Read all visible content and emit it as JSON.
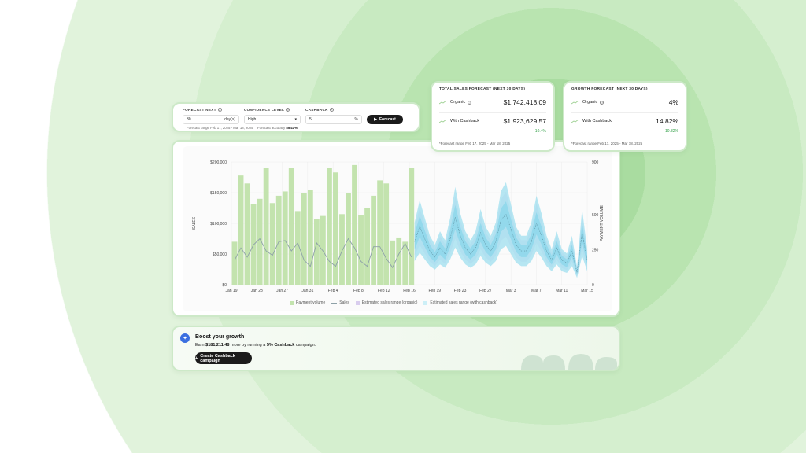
{
  "controls": {
    "labels": [
      "FORECAST NEXT",
      "CONFIDENCE LEVEL",
      "CASHBACK"
    ],
    "forecast_value": "30",
    "forecast_unit": "day(s)",
    "confidence_value": "High",
    "cashback_value": "5",
    "cashback_unit": "%",
    "forecast_button": "Forecast",
    "range_text": "Forecast range Feb 17, 2025 - Mar 18, 2025",
    "accuracy_label": "Forecast accuracy",
    "accuracy_value": "85.41%"
  },
  "total_sales": {
    "header": "TOTAL SALES FORECAST (NEXT 30 DAYS)",
    "organic_label": "Organic",
    "organic_value": "$1,742,418.09",
    "cashback_label": "With Cashback",
    "cashback_value": "$1,923,629.57",
    "delta": "+10.4%",
    "footer": "*Forecast range Feb 17, 2025 - Mar 18, 2025"
  },
  "growth": {
    "header": "GROWTH FORECAST (NEXT 30 DAYS)",
    "organic_label": "Organic",
    "organic_value": "4%",
    "cashback_label": "With Cashback",
    "cashback_value": "14.82%",
    "delta": "+10.82%",
    "footer": "*Forecast range Feb 17, 2025 - Mar 18, 2025"
  },
  "boost": {
    "title": "Boost your growth",
    "text_pre": "Earn",
    "amount": "$181,211.48",
    "text_mid": "more by running a",
    "campaign": "5% Cashback",
    "text_post": "campaign.",
    "button": "Create Cashback campaign"
  },
  "colors": {
    "bar": "#c3e3ae",
    "sales_line": "#8ea1a8",
    "band_cashback": "#9fdfef",
    "band_organic": "#d9cdee",
    "accent_green": "#2f9e44"
  },
  "chart_data": {
    "type": "bar",
    "ylabel": "SALES",
    "y2label": "PAYMENT VOLUME",
    "y_ticks": [
      "$0",
      "$50,000",
      "$100,000",
      "$150,000",
      "$200,000"
    ],
    "y2_ticks": [
      "0",
      "250",
      "500",
      "900"
    ],
    "ylim": [
      0,
      200000
    ],
    "x_ticks": [
      "Jan 19",
      "Jan 23",
      "Jan 27",
      "Jan 31",
      "Feb 4",
      "Feb 8",
      "Feb 12",
      "Feb 16",
      "Feb 19",
      "Feb 23",
      "Feb 27",
      "Mar 3",
      "Mar 7",
      "Mar 11",
      "Mar 15"
    ],
    "legend": [
      "Payment volume",
      "Sales",
      "Estimated sales range (organic)",
      "Estimated sales range (with cashback)"
    ],
    "payment_volume": [
      70000,
      178000,
      165000,
      132000,
      140000,
      190000,
      133000,
      145000,
      152000,
      190000,
      120000,
      150000,
      155000,
      107000,
      112000,
      190000,
      183000,
      115000,
      150000,
      195000,
      113000,
      125000,
      145000,
      170000,
      165000,
      72000,
      77000,
      70000,
      190000
    ],
    "sales": [
      40000,
      60000,
      45000,
      65000,
      75000,
      55000,
      48000,
      70000,
      72000,
      55000,
      68000,
      40000,
      30000,
      68000,
      55000,
      38000,
      30000,
      55000,
      75000,
      60000,
      38000,
      30000,
      62000,
      62000,
      43000,
      28000,
      50000,
      67000,
      45000
    ],
    "forecast_center": [
      70000,
      95000,
      75000,
      55000,
      45000,
      60000,
      50000,
      75000,
      110000,
      80000,
      60000,
      50000,
      60000,
      85000,
      65000,
      55000,
      70000,
      105000,
      115000,
      90000,
      65000,
      55000,
      55000,
      70000,
      100000,
      80000,
      55000,
      40000,
      60000,
      40000,
      35000,
      55000,
      20000,
      85000,
      40000
    ]
  }
}
